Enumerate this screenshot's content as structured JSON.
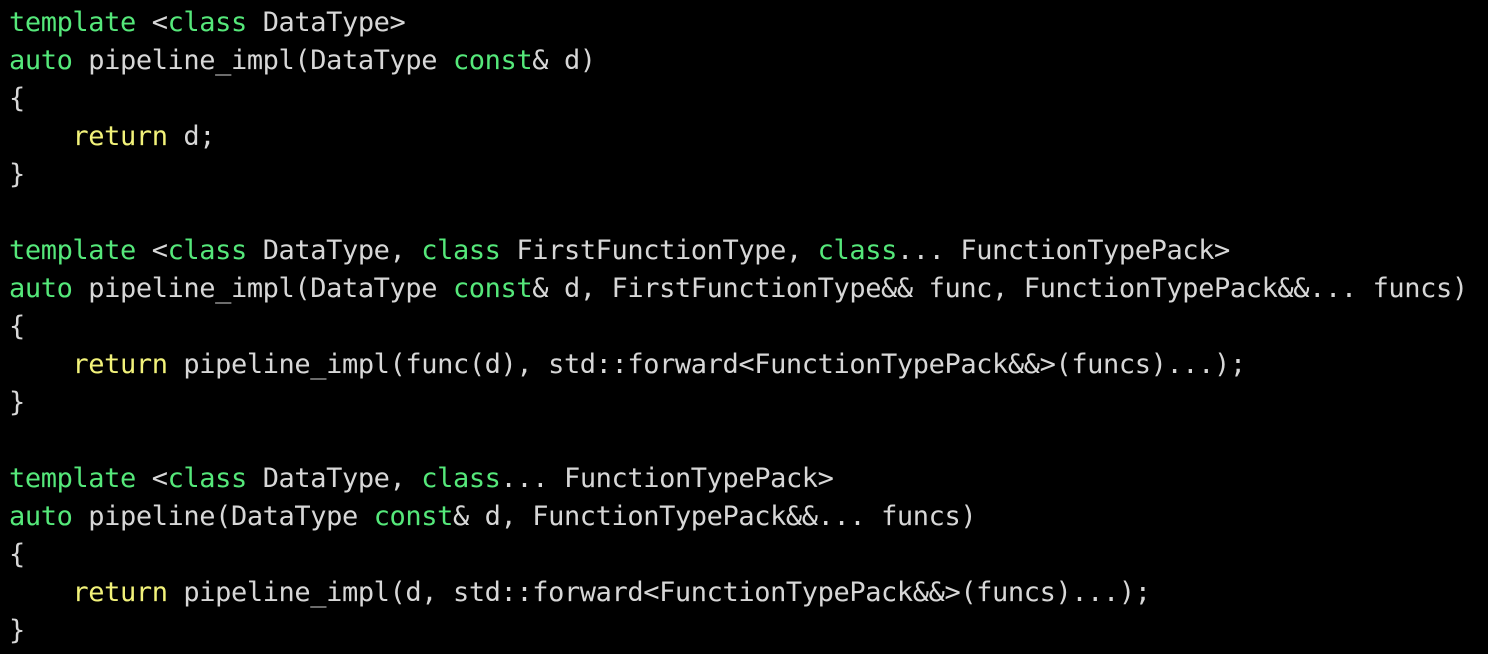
{
  "colors": {
    "background": "#000000",
    "plain": "#d7d7d7",
    "keyword_type": "#55e87a",
    "keyword_control": "#f2f27a"
  },
  "code_lines": [
    [
      {
        "t": "template",
        "k": "kw"
      },
      {
        "t": " <",
        "k": "plain"
      },
      {
        "t": "class",
        "k": "kw"
      },
      {
        "t": " DataType>",
        "k": "plain"
      }
    ],
    [
      {
        "t": "auto",
        "k": "kw"
      },
      {
        "t": " pipeline_impl(DataType ",
        "k": "plain"
      },
      {
        "t": "const",
        "k": "kw"
      },
      {
        "t": "& d)",
        "k": "plain"
      }
    ],
    [
      {
        "t": "{",
        "k": "plain"
      }
    ],
    [
      {
        "t": "    ",
        "k": "plain"
      },
      {
        "t": "return",
        "k": "ctl"
      },
      {
        "t": " d;",
        "k": "plain"
      }
    ],
    [
      {
        "t": "}",
        "k": "plain"
      }
    ],
    [],
    [
      {
        "t": "template",
        "k": "kw"
      },
      {
        "t": " <",
        "k": "plain"
      },
      {
        "t": "class",
        "k": "kw"
      },
      {
        "t": " DataType, ",
        "k": "plain"
      },
      {
        "t": "class",
        "k": "kw"
      },
      {
        "t": " FirstFunctionType, ",
        "k": "plain"
      },
      {
        "t": "class",
        "k": "kw"
      },
      {
        "t": "... FunctionTypePack>",
        "k": "plain"
      }
    ],
    [
      {
        "t": "auto",
        "k": "kw"
      },
      {
        "t": " pipeline_impl(DataType ",
        "k": "plain"
      },
      {
        "t": "const",
        "k": "kw"
      },
      {
        "t": "& d, FirstFunctionType&& func, FunctionTypePack&&... funcs)",
        "k": "plain"
      }
    ],
    [
      {
        "t": "{",
        "k": "plain"
      }
    ],
    [
      {
        "t": "    ",
        "k": "plain"
      },
      {
        "t": "return",
        "k": "ctl"
      },
      {
        "t": " pipeline_impl(func(d), std::forward<FunctionTypePack&&>(funcs)...);",
        "k": "plain"
      }
    ],
    [
      {
        "t": "}",
        "k": "plain"
      }
    ],
    [],
    [
      {
        "t": "template",
        "k": "kw"
      },
      {
        "t": " <",
        "k": "plain"
      },
      {
        "t": "class",
        "k": "kw"
      },
      {
        "t": " DataType, ",
        "k": "plain"
      },
      {
        "t": "class",
        "k": "kw"
      },
      {
        "t": "... FunctionTypePack>",
        "k": "plain"
      }
    ],
    [
      {
        "t": "auto",
        "k": "kw"
      },
      {
        "t": " pipeline(DataType ",
        "k": "plain"
      },
      {
        "t": "const",
        "k": "kw"
      },
      {
        "t": "& d, FunctionTypePack&&... funcs)",
        "k": "plain"
      }
    ],
    [
      {
        "t": "{",
        "k": "plain"
      }
    ],
    [
      {
        "t": "    ",
        "k": "plain"
      },
      {
        "t": "return",
        "k": "ctl"
      },
      {
        "t": " pipeline_impl(d, std::forward<FunctionTypePack&&>(funcs)...);",
        "k": "plain"
      }
    ],
    [
      {
        "t": "}",
        "k": "plain"
      }
    ]
  ]
}
